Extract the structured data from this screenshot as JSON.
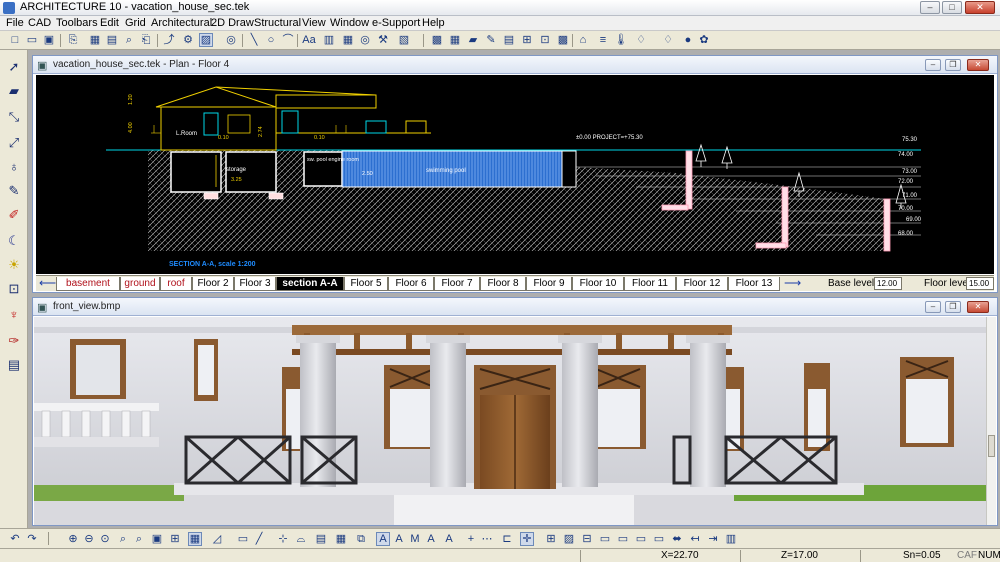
{
  "window": {
    "title": "ARCHITECTURE 10 - vacation_house_sec.tek",
    "minimize": "–",
    "maximize": "□",
    "close": "✕"
  },
  "menu": [
    "File",
    "CAD",
    "Toolbars",
    "Edit",
    "Grid",
    "Architectural",
    "2D Draw",
    "Structural",
    "View",
    "Window",
    "e-Support",
    "Help"
  ],
  "toolbar_top_glyphs": [
    "□",
    "▭",
    "▣",
    "⎘",
    "▦",
    "▤",
    "⌕",
    "⎗",
    "⤴",
    "⚙",
    "▨",
    "╲",
    "○",
    "⌒",
    "Aa",
    "▥",
    "▦",
    "◎",
    "⚒",
    "▧",
    "▩",
    "▦",
    "▰",
    "✎",
    "▤",
    "⊞",
    "⊡",
    "▩",
    "⌂",
    "≡",
    "🌡",
    "♢",
    "●",
    "✿"
  ],
  "toolbar_left_icons": [
    "arrow-select-icon",
    "eraser-icon",
    "node-edit-icon",
    "transform-icon",
    "pipette-icon",
    "pencil-icon",
    "red-pen-icon",
    "moon-icon",
    "light-icon",
    "text-3d-icon",
    "pipette-red-icon",
    "property-icon"
  ],
  "plan_window": {
    "title": "vacation_house_sec.tek - Plan - Floor 4",
    "drawing": {
      "labels": {
        "room": "L.Room",
        "storage": "storage",
        "pool_room": "sw. pool engine room",
        "pool": "swimming pool",
        "project_level": "±0.00 PROJECT=+75.30",
        "section_caption": "SECTION A-A, scale 1:200"
      },
      "dims": [
        "1.20",
        "4.00",
        "2.74",
        "0.10",
        "3.25",
        "2.50",
        "0.10"
      ],
      "levels": [
        "75.30",
        "74.00",
        "73.00",
        "72.00",
        "71.00",
        "70.00",
        "69.00",
        "68.00"
      ]
    },
    "floor_tabs": [
      {
        "label": "basement",
        "state": "red"
      },
      {
        "label": "ground",
        "state": "red"
      },
      {
        "label": "roof",
        "state": "red"
      },
      {
        "label": "Floor 2",
        "state": "normal"
      },
      {
        "label": "Floor 3",
        "state": "normal"
      },
      {
        "label": "section A-A",
        "state": "active"
      },
      {
        "label": "Floor 5",
        "state": "normal"
      },
      {
        "label": "Floor 6",
        "state": "normal"
      },
      {
        "label": "Floor 7",
        "state": "normal"
      },
      {
        "label": "Floor 8",
        "state": "normal"
      },
      {
        "label": "Floor 9",
        "state": "normal"
      },
      {
        "label": "Floor 10",
        "state": "normal"
      },
      {
        "label": "Floor 11",
        "state": "normal"
      },
      {
        "label": "Floor 12",
        "state": "normal"
      },
      {
        "label": "Floor 13",
        "state": "normal"
      }
    ],
    "base_level_label": "Base level:",
    "base_level_value": "12.00",
    "floor_level_label": "Floor level:",
    "floor_level_value": "15.00"
  },
  "front_window": {
    "title": "front_view.bmp"
  },
  "toolbar_bottom_glyphs": [
    "↶",
    "↷",
    "⊕",
    "⊖",
    "⊙",
    "⌕",
    "▣",
    "⊞",
    "▦",
    "◿",
    "▭",
    "╱",
    "⊹",
    "⌓",
    "▤",
    "▦",
    "⧉",
    "A",
    "A",
    "M",
    "A",
    "A",
    "+",
    "⋯",
    "⊏",
    "✛",
    "⊞",
    "▨",
    "⊟",
    "▭",
    "⬌",
    "↤",
    "⇥",
    "▥",
    "▦"
  ],
  "status": {
    "x": "X=22.70",
    "z": "Z=17.00",
    "sn": "Sn=0.05",
    "caf": "CAF",
    "num": "NUM"
  },
  "colors": {
    "drawing_bg": "#000000",
    "pool_blue": "#2c6fd0",
    "cad_yellow": "#f0d000",
    "cad_cyan": "#00d8e8",
    "tab_active": "#000000"
  }
}
